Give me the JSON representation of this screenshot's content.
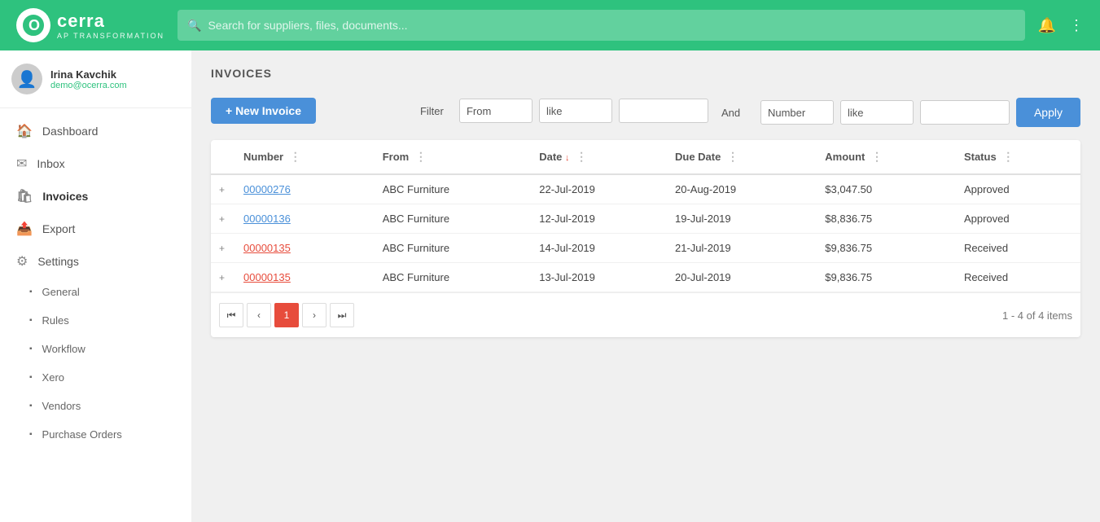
{
  "app": {
    "name": "cerra",
    "subtitle": "AP TRANSFORMATION",
    "logo_letter": "O"
  },
  "search": {
    "placeholder": "Search for suppliers, files, documents..."
  },
  "user": {
    "name": "Irina Kavchik",
    "email": "demo@ocerra.com"
  },
  "sidebar": {
    "items": [
      {
        "id": "dashboard",
        "label": "Dashboard",
        "icon": "🏠"
      },
      {
        "id": "inbox",
        "label": "Inbox",
        "icon": "✉"
      },
      {
        "id": "invoices",
        "label": "Invoices",
        "icon": "🛍",
        "active": true
      },
      {
        "id": "export",
        "label": "Export",
        "icon": "🛍"
      },
      {
        "id": "settings",
        "label": "Settings",
        "icon": "⚙"
      }
    ],
    "submenu": [
      {
        "id": "general",
        "label": "General"
      },
      {
        "id": "rules",
        "label": "Rules"
      },
      {
        "id": "workflow",
        "label": "Workflow"
      },
      {
        "id": "xero",
        "label": "Xero"
      },
      {
        "id": "vendors",
        "label": "Vendors"
      },
      {
        "id": "purchase-orders",
        "label": "Purchase Orders"
      }
    ]
  },
  "page": {
    "title": "INVOICES",
    "new_invoice_btn": "+ New Invoice"
  },
  "filter": {
    "label": "Filter",
    "and_label": "And",
    "row1": {
      "field": "From",
      "operator": "like",
      "value": ""
    },
    "row2": {
      "field": "Number",
      "operator": "like",
      "value": ""
    },
    "apply_btn": "Apply"
  },
  "table": {
    "columns": [
      {
        "id": "expand",
        "label": ""
      },
      {
        "id": "number",
        "label": "Number"
      },
      {
        "id": "from",
        "label": "From"
      },
      {
        "id": "date",
        "label": "Date",
        "sorted": true,
        "sort_dir": "desc"
      },
      {
        "id": "due_date",
        "label": "Due Date"
      },
      {
        "id": "amount",
        "label": "Amount"
      },
      {
        "id": "status",
        "label": "Status"
      }
    ],
    "rows": [
      {
        "expand": "+",
        "number": "00000276",
        "number_color": "blue",
        "from": "ABC Furniture",
        "date": "22-Jul-2019",
        "due_date": "20-Aug-2019",
        "amount": "$3,047.50",
        "status": "Approved"
      },
      {
        "expand": "+",
        "number": "00000136",
        "number_color": "blue",
        "from": "ABC Furniture",
        "date": "12-Jul-2019",
        "due_date": "19-Jul-2019",
        "amount": "$8,836.75",
        "status": "Approved"
      },
      {
        "expand": "+",
        "number": "00000135",
        "number_color": "red",
        "from": "ABC Furniture",
        "date": "14-Jul-2019",
        "due_date": "21-Jul-2019",
        "amount": "$9,836.75",
        "status": "Received"
      },
      {
        "expand": "+",
        "number": "00000135",
        "number_color": "red",
        "from": "ABC Furniture",
        "date": "13-Jul-2019",
        "due_date": "20-Jul-2019",
        "amount": "$9,836.75",
        "status": "Received"
      }
    ]
  },
  "pagination": {
    "current_page": 1,
    "total_pages": 1,
    "info": "1 - 4 of 4 items"
  }
}
